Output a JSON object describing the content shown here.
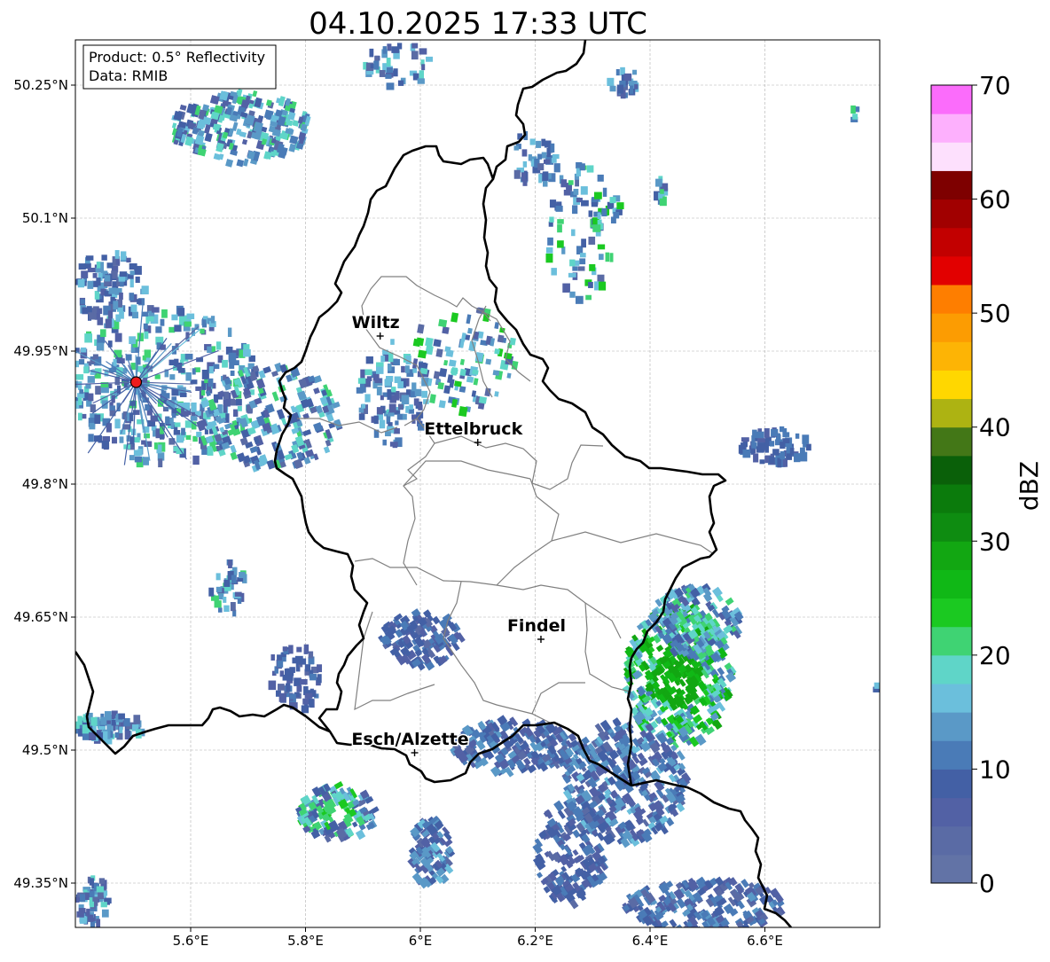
{
  "title": "04.10.2025 17:33 UTC",
  "infobox": {
    "line1": "Product: 0.5° Reflectivity",
    "line2": "Data: RMIB"
  },
  "lat_ticks": [
    "50.25°N",
    "50.1°N",
    "49.95°N",
    "49.8°N",
    "49.65°N",
    "49.5°N",
    "49.35°N"
  ],
  "lon_ticks": [
    "5.6°E",
    "5.8°E",
    "6°E",
    "6.2°E",
    "6.4°E",
    "6.6°E"
  ],
  "cities": [
    {
      "name": "Wiltz",
      "lon": 5.93,
      "lat": 49.967
    },
    {
      "name": "Ettelbruck",
      "lon": 6.1,
      "lat": 49.847
    },
    {
      "name": "Findel",
      "lon": 6.21,
      "lat": 49.625
    },
    {
      "name": "Esch/Alzette",
      "lon": 5.99,
      "lat": 49.497
    }
  ],
  "radar_site": {
    "lon": 5.505,
    "lat": 49.915,
    "color": "#ee1c1c"
  },
  "colorbar": {
    "label": "dBZ",
    "ticks": [
      "0",
      "10",
      "20",
      "30",
      "40",
      "50",
      "60",
      "70"
    ],
    "min": 0,
    "max": 70,
    "step": 2.5,
    "colors": [
      "#6273a6",
      "#5a6ba5",
      "#5261a5",
      "#4360a5",
      "#4a7bb7",
      "#5a99c7",
      "#6bbfdc",
      "#5fd5c8",
      "#3fd373",
      "#1bc921",
      "#10b816",
      "#12a712",
      "#0e8c11",
      "#0b7b0c",
      "#0a6009",
      "#437717",
      "#adb312",
      "#ffd700",
      "#fdb405",
      "#fc9c02",
      "#fe7e00",
      "#e20000",
      "#c20000",
      "#a10000",
      "#7e0000",
      "#fde0fd",
      "#fdb0fd",
      "#fb6cfb",
      "#ea36ea"
    ]
  }
}
